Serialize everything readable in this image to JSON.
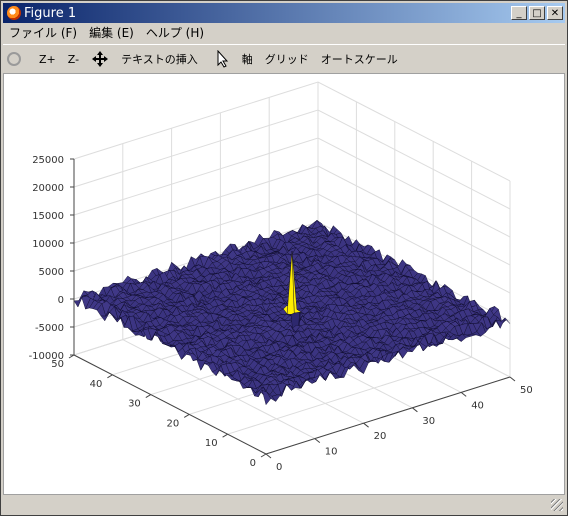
{
  "window": {
    "title": "Figure 1"
  },
  "menu": {
    "items": [
      "ファイル (F)",
      "編集 (E)",
      "ヘルプ (H)"
    ]
  },
  "toolbar": {
    "zoom_in": "Z+",
    "zoom_out": "Z-",
    "insert_text": "テキストの挿入",
    "axes": "軸",
    "grid": "グリッド",
    "autoscale": "オートスケール"
  },
  "chart_data": {
    "type": "surface",
    "title": "",
    "x": {
      "min": 0,
      "max": 50,
      "ticks": [
        "0",
        "10",
        "20",
        "30",
        "40",
        "50"
      ]
    },
    "y": {
      "min": 0,
      "max": 50,
      "ticks": [
        "0",
        "10",
        "20",
        "30",
        "40",
        "50"
      ]
    },
    "z": {
      "min": -10000,
      "max": 25000,
      "ticks": [
        "-10000",
        "-5000",
        "0",
        "5000",
        "10000",
        "15000",
        "20000",
        "25000"
      ]
    },
    "grid": true,
    "surface": {
      "base_level": 0,
      "noise_amplitude": 1500,
      "peak": {
        "x": 25,
        "y": 25,
        "z_max": 10500,
        "z_min": -8500
      }
    },
    "colors": {
      "surface": "#3a3580",
      "edge": "#0c0a2a",
      "peak": "#ffee00",
      "grid": "#dddddd"
    }
  }
}
